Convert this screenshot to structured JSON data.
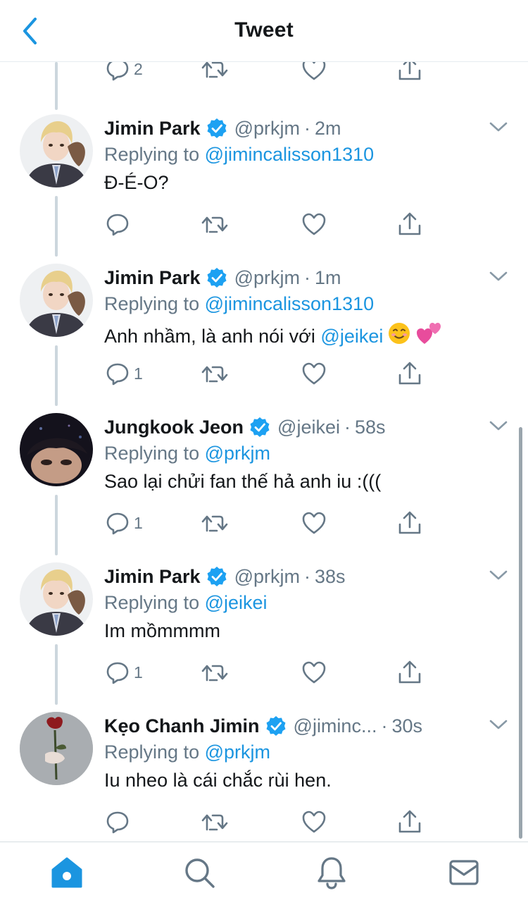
{
  "header": {
    "title": "Tweet"
  },
  "top_partial": {
    "reply_count": "2"
  },
  "tweets": [
    {
      "name": "Jimin Park",
      "handle": "@prkjm",
      "time": "2m",
      "replying_prefix": "Replying to",
      "replying_to": "@jimincalisson1310",
      "text": "Đ-É-O?",
      "reply_count": ""
    },
    {
      "name": "Jimin Park",
      "handle": "@prkjm",
      "time": "1m",
      "replying_prefix": "Replying to",
      "replying_to": "@jimincalisson1310",
      "text": "Anh nhầm, là anh nói với",
      "text_mention": "@jeikei",
      "emojis": [
        "smiling-face-emoji",
        "two-hearts-emoji"
      ],
      "reply_count": "1"
    },
    {
      "name": "Jungkook Jeon",
      "handle": "@jeikei",
      "time": "58s",
      "replying_prefix": "Replying to",
      "replying_to": "@prkjm",
      "text": "Sao lại chửi fan thế hả anh iu :(((",
      "reply_count": "1"
    },
    {
      "name": "Jimin Park",
      "handle": "@prkjm",
      "time": "38s",
      "replying_prefix": "Replying to",
      "replying_to": "@jeikei",
      "text": "Im mồmmmm",
      "reply_count": "1"
    },
    {
      "name": "Kẹo Chanh Jimin",
      "handle": "@jiminc...",
      "time": "30s",
      "replying_prefix": "Replying to",
      "replying_to": "@prkjm",
      "text": "Iu nheo là cái chắc rùi hen.",
      "reply_count": ""
    }
  ],
  "colors": {
    "accent": "#1b95e0",
    "secondary_text": "#657786",
    "primary_text": "#14171a",
    "verified": "#1da1f2",
    "thread_line": "#ccd6dd"
  },
  "tabbar": {
    "tabs": [
      "home-icon",
      "search-icon",
      "notifications-icon",
      "messages-icon"
    ],
    "active": "home-icon"
  }
}
